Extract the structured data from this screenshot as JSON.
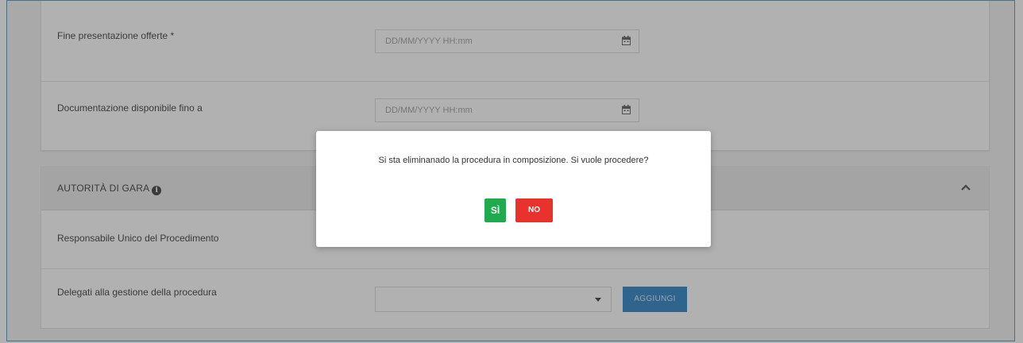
{
  "form": {
    "fields": [
      {
        "label": "Fine presentazione offerte *",
        "placeholder": "DD/MM/YYYY HH:mm"
      },
      {
        "label": "Documentazione disponibile fino a",
        "placeholder": "DD/MM/YYYY HH:mm"
      }
    ]
  },
  "section": {
    "title": "AUTORITÀ DI GARA",
    "rows": [
      {
        "label": "Responsabile Unico del Procedimento"
      },
      {
        "label": "Delegati alla gestione della procedura"
      }
    ],
    "add_button_label": "AGGIUNGI"
  },
  "dialog": {
    "message": "Si sta eliminanado la procedura in composizione. Si vuole procedere?",
    "yes_label": "SÌ",
    "no_label": "NO"
  },
  "colors": {
    "yes": "#1fab4c",
    "no": "#e8322b",
    "primary": "#1f7cc2"
  },
  "icons": [
    "calendar-icon",
    "info-icon",
    "chevron-up-icon",
    "dropdown-caret-icon"
  ]
}
